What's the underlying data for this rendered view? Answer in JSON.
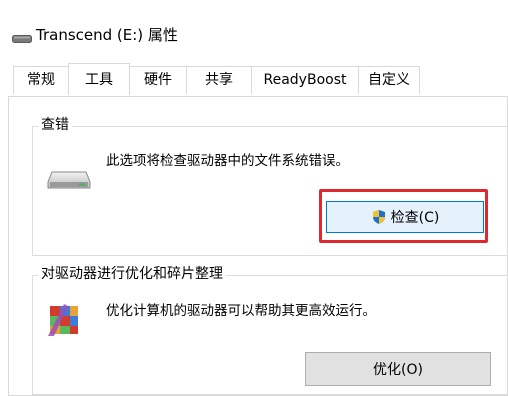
{
  "window": {
    "title": "Transcend (E:) 属性"
  },
  "tabs": [
    {
      "label": "常规",
      "selected": false
    },
    {
      "label": "工具",
      "selected": true
    },
    {
      "label": "硬件",
      "selected": false
    },
    {
      "label": "共享",
      "selected": false
    },
    {
      "label": "ReadyBoost",
      "selected": false
    },
    {
      "label": "自定义",
      "selected": false
    }
  ],
  "error_check": {
    "group_label": "查错",
    "description": "此选项将检查驱动器中的文件系统错误。",
    "button_label": "检查(C)",
    "icon": "drive-icon",
    "button_icon": "uac-shield-icon"
  },
  "optimize": {
    "group_label": "对驱动器进行优化和碎片整理",
    "description": "优化计算机的驱动器可以帮助其更高效运行。",
    "button_label": "优化(O)",
    "icon": "defrag-icon"
  },
  "colors": {
    "highlight": "#e0282e",
    "focus_border": "#0078d7",
    "button_face": "#e1e1e1"
  }
}
